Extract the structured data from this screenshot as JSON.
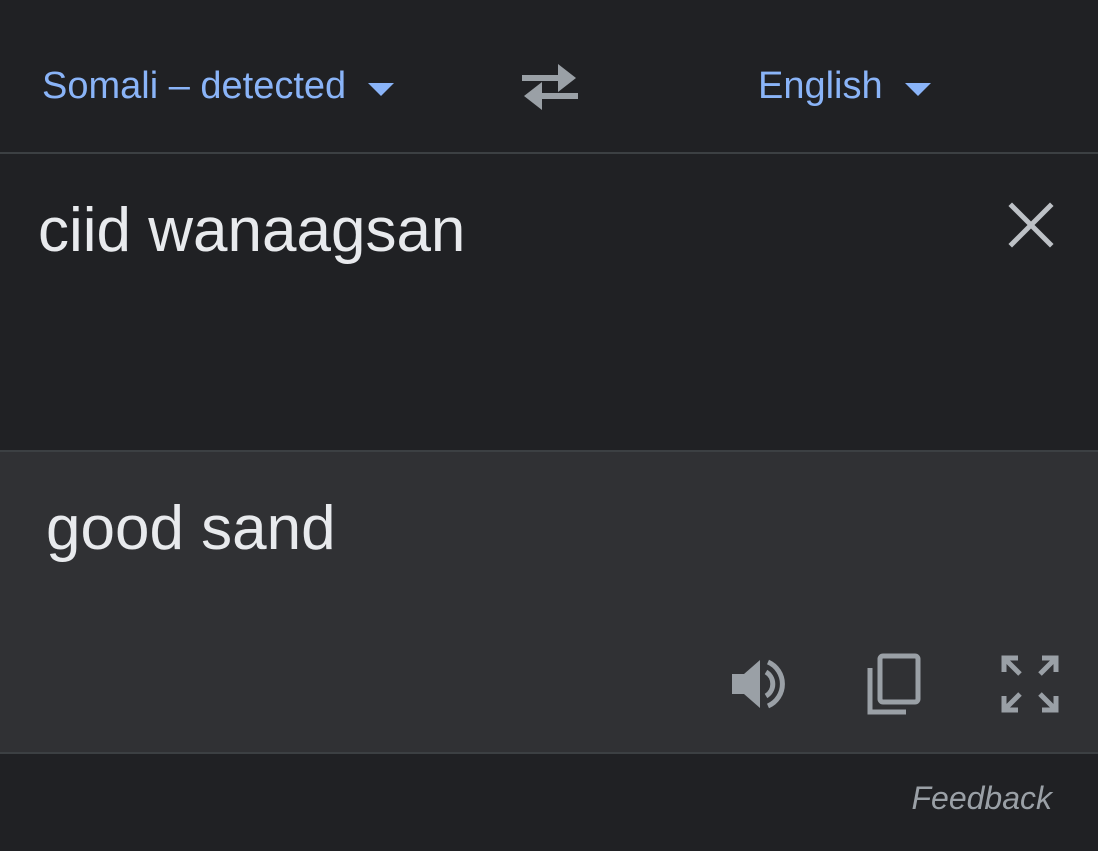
{
  "languages": {
    "source_label": "Somali – detected",
    "target_label": "English"
  },
  "input": {
    "text": "ciid wanaagsan"
  },
  "output": {
    "text": "good sand"
  },
  "footer": {
    "feedback_label": "Feedback"
  },
  "icons": {
    "swap": "swap-arrows-icon",
    "clear": "close-icon",
    "listen": "speaker-icon",
    "copy": "copy-icon",
    "expand": "fullscreen-icon"
  },
  "colors": {
    "accent": "#8ab4f8",
    "background": "#202124",
    "result_background": "#303134",
    "text": "#e8eaed",
    "icon": "#9aa0a6"
  }
}
